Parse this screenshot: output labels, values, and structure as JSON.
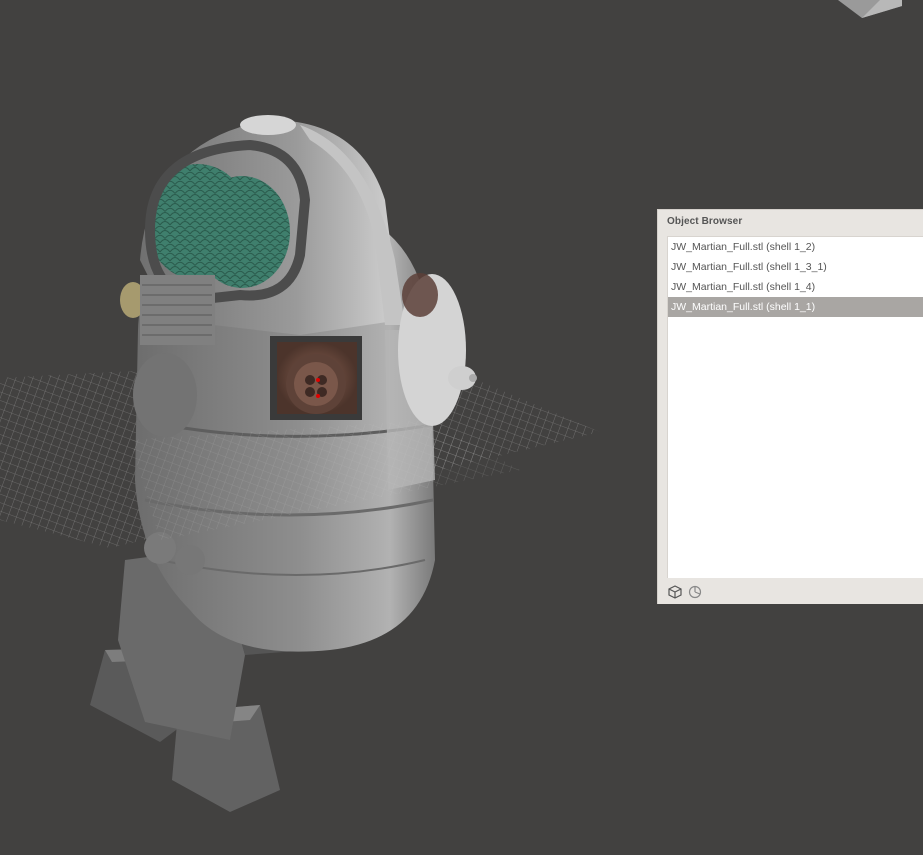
{
  "viewport": {
    "background": "#424140",
    "model_body_color": "#8f8f8f",
    "eye_color": "#3e7d6b",
    "core_color": "#6b4a3e",
    "grid_color": "#bdbdbd"
  },
  "object_browser": {
    "title": "Object Browser",
    "items": [
      {
        "label": "JW_Martian_Full.stl (shell 1_2)",
        "selected": false
      },
      {
        "label": "JW_Martian_Full.stl (shell 1_3_1)",
        "selected": false
      },
      {
        "label": "JW_Martian_Full.stl (shell 1_4)",
        "selected": false
      },
      {
        "label": "JW_Martian_Full.stl (shell 1_1)",
        "selected": true
      }
    ],
    "footer_icons": [
      "cube-icon",
      "pie-chart-icon"
    ]
  }
}
